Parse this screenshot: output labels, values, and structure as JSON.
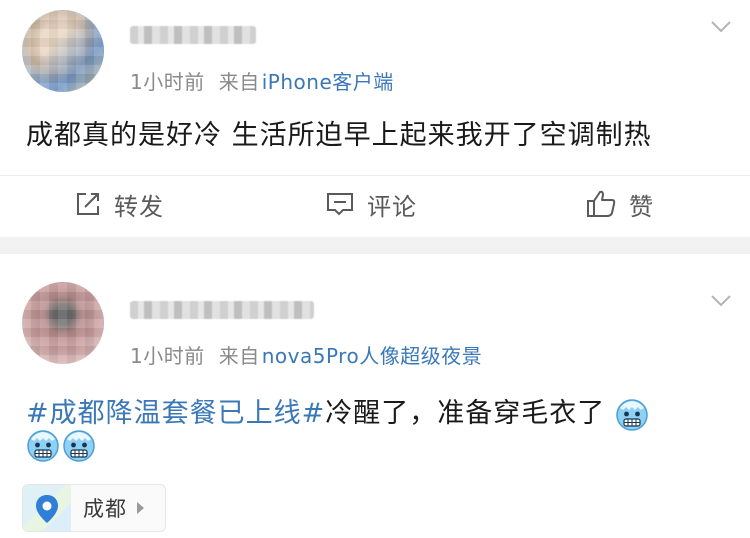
{
  "posts": [
    {
      "time": "1小时前",
      "from_label": "来自",
      "source": "iPhone客户端",
      "text": "成都真的是好冷 生活所迫早上起来我开了空调制热",
      "actions": {
        "repost": "转发",
        "comment": "评论",
        "like": "赞"
      }
    },
    {
      "time": "1小时前",
      "from_label": "来自",
      "source": "nova5Pro人像超级夜景",
      "topic": "#成都降温套餐已上线#",
      "text": "冷醒了，准备穿毛衣了",
      "emoji_name": "cold-face-emoji",
      "location": "成都"
    }
  ],
  "colors": {
    "link": "#3a78b8",
    "meta": "#8a8a8a",
    "divider": "#f2f2f2",
    "emoji_face": "#8fd0f5"
  },
  "icons": [
    "chevron-down-icon",
    "repost-icon",
    "comment-icon",
    "like-icon",
    "location-pin-icon",
    "cold-face-emoji"
  ]
}
